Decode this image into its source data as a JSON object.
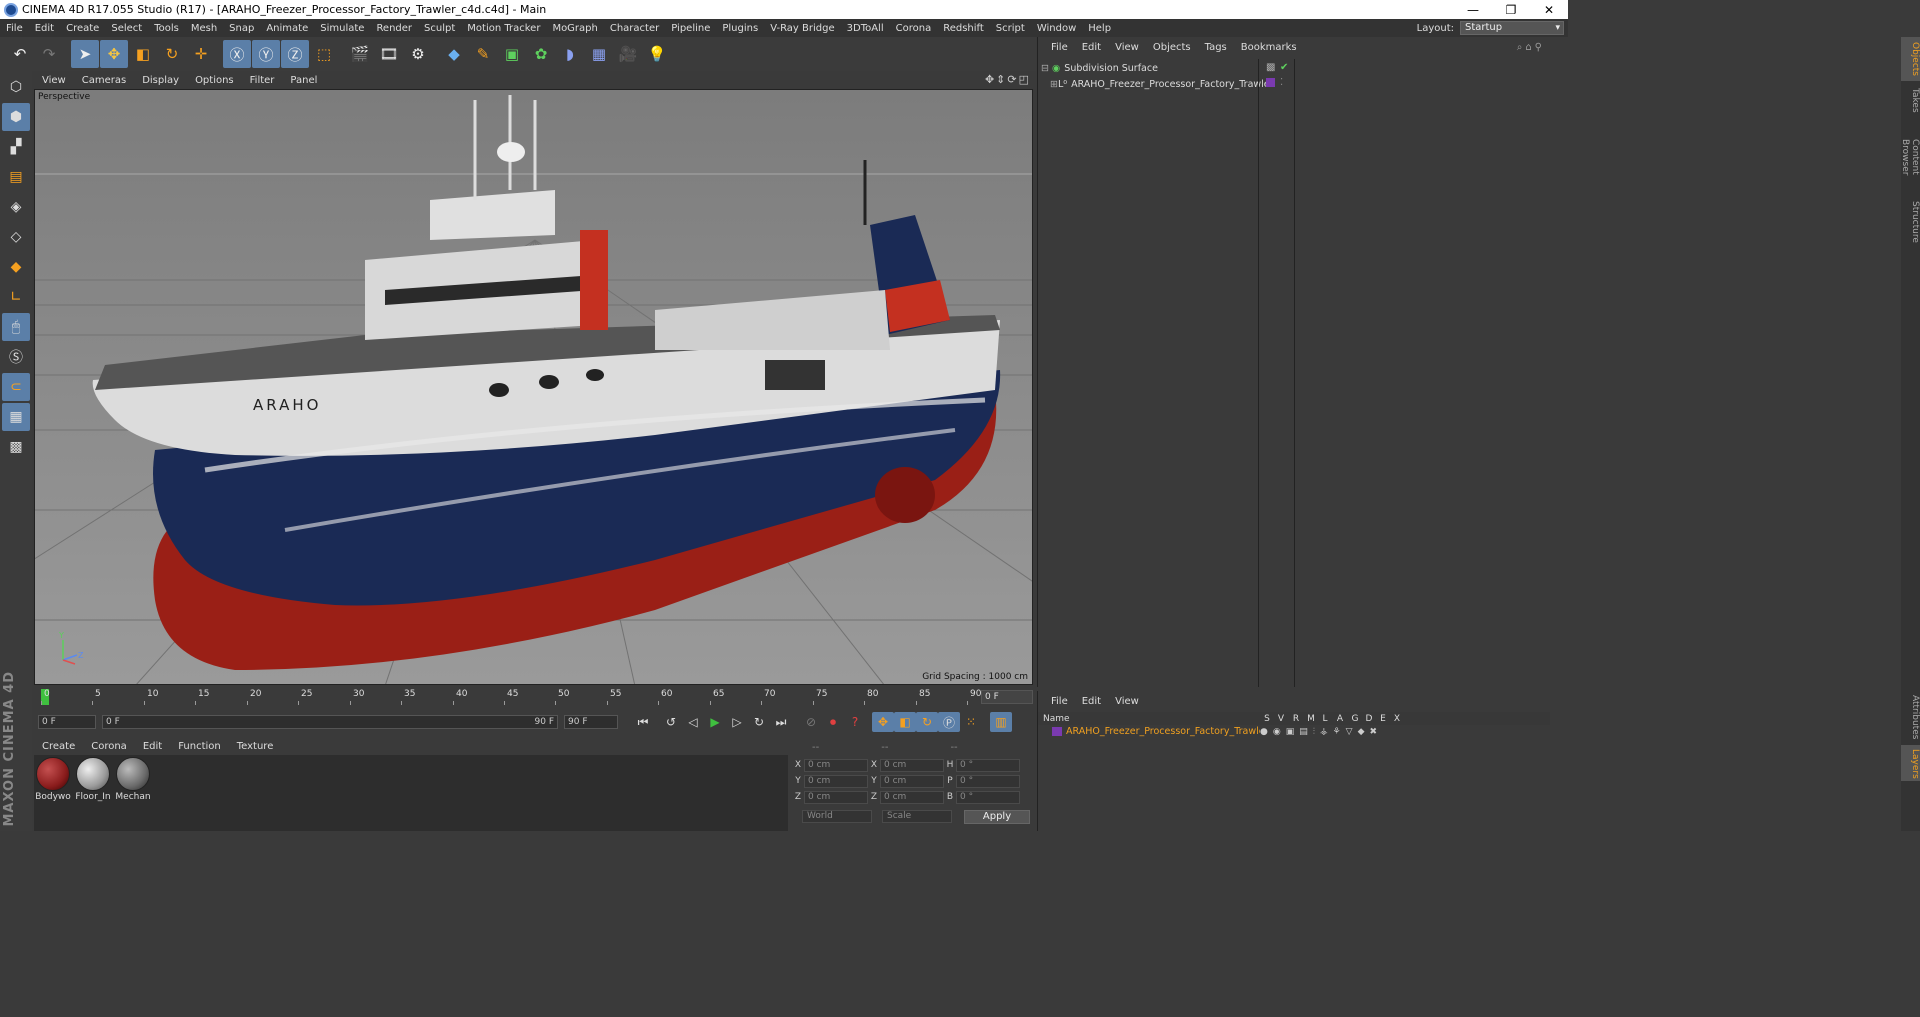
{
  "window": {
    "title": "CINEMA 4D R17.055 Studio (R17) - [ARAHO_Freezer_Processor_Factory_Trawler_c4d.c4d] - Main",
    "min": "—",
    "max": "❐",
    "close": "✕"
  },
  "menubar": {
    "items": [
      "File",
      "Edit",
      "Create",
      "Select",
      "Tools",
      "Mesh",
      "Snap",
      "Animate",
      "Simulate",
      "Render",
      "Sculpt",
      "Motion Tracker",
      "MoGraph",
      "Character",
      "Pipeline",
      "Plugins",
      "V-Ray Bridge",
      "3DToAll",
      "Corona",
      "Redshift",
      "Script",
      "Window",
      "Help"
    ],
    "layout_label": "Layout:",
    "layout_value": "Startup"
  },
  "viewport": {
    "menu": [
      "View",
      "Cameras",
      "Display",
      "Options",
      "Filter",
      "Panel"
    ],
    "label": "Perspective",
    "grid_spacing": "Grid Spacing : 1000 cm",
    "ship_name": "ARAHO",
    "axis_y": "Y",
    "axis_z": "Z"
  },
  "timeline": {
    "ticks": [
      "0",
      "5",
      "10",
      "15",
      "20",
      "25",
      "30",
      "35",
      "40",
      "45",
      "50",
      "55",
      "60",
      "65",
      "70",
      "75",
      "80",
      "85",
      "90"
    ],
    "current_frame": "0 F",
    "start_frame": "0 F",
    "range_start": "0 F",
    "range_end": "90 F",
    "end_frame": "90 F",
    "frame_end_display": "0 F"
  },
  "materials": {
    "menu": [
      "Create",
      "Corona",
      "Edit",
      "Function",
      "Texture"
    ],
    "items": [
      {
        "name": "Bodywo",
        "color": "#8a1c1c"
      },
      {
        "name": "Floor_In",
        "color": "#9a9a9a"
      },
      {
        "name": "Mechan",
        "color": "#6a6a6a"
      }
    ]
  },
  "coords": {
    "headers": [
      "--",
      "--",
      "--"
    ],
    "rows": [
      {
        "l1": "X",
        "v1": "0 cm",
        "l2": "X",
        "v2": "0 cm",
        "l3": "H",
        "v3": "0 °"
      },
      {
        "l1": "Y",
        "v1": "0 cm",
        "l2": "Y",
        "v2": "0 cm",
        "l3": "P",
        "v3": "0 °"
      },
      {
        "l1": "Z",
        "v1": "0 cm",
        "l2": "Z",
        "v2": "0 cm",
        "l3": "B",
        "v3": "0 °"
      }
    ],
    "world": "World",
    "scale": "Scale",
    "apply": "Apply"
  },
  "objects": {
    "menu": [
      "File",
      "Edit",
      "View",
      "Objects",
      "Tags",
      "Bookmarks"
    ],
    "items": [
      {
        "name": "Subdivision Surface"
      },
      {
        "name": "ARAHO_Freezer_Processor_Factory_Trawler"
      }
    ]
  },
  "layers": {
    "menu": [
      "File",
      "Edit",
      "View"
    ],
    "columns": [
      "Name",
      "S",
      "V",
      "R",
      "M",
      "L",
      "A",
      "G",
      "D",
      "E",
      "X"
    ],
    "row_name": "ARAHO_Freezer_Processor_Factory_Trawler"
  },
  "right_tabs": [
    "Objects",
    "Takes",
    "Content Browser",
    "Structure",
    "Attributes",
    "Layers"
  ],
  "brand": "MAXON CINEMA 4D",
  "colors": {
    "accent": "#5b7fa8",
    "layer_name": "#f0a020",
    "hull_navy": "#1a2a55",
    "hull_red": "#9a1f16"
  }
}
